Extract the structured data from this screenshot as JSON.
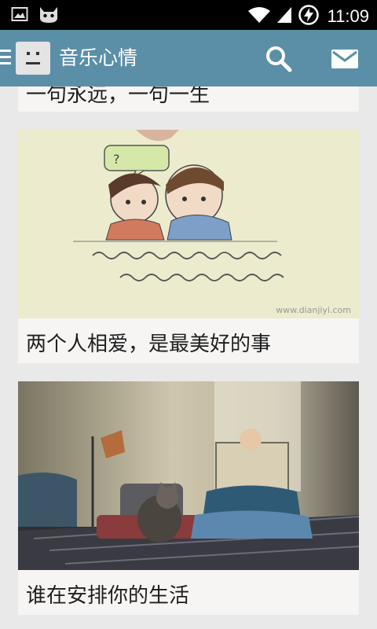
{
  "status_bar": {
    "time": "11:09",
    "icons": [
      "gallery-notification-icon",
      "android-debug-icon",
      "wifi-icon",
      "signal-icon",
      "battery-charging-icon"
    ]
  },
  "action_bar": {
    "title": "音乐心情",
    "color": "#5b8fa8",
    "icons": [
      "drawer-icon",
      "app-logo-icon",
      "search-icon",
      "mail-icon"
    ]
  },
  "feed": {
    "items": [
      {
        "caption": "一句永远，一句一生"
      },
      {
        "caption": "两个人相爱，是最美好的事",
        "image": "couple-sketch-illustration",
        "watermark": "www.dianjiyi.com"
      },
      {
        "caption": "谁在安排你的生活",
        "image": "person-reading-with-cat-photo"
      }
    ]
  }
}
